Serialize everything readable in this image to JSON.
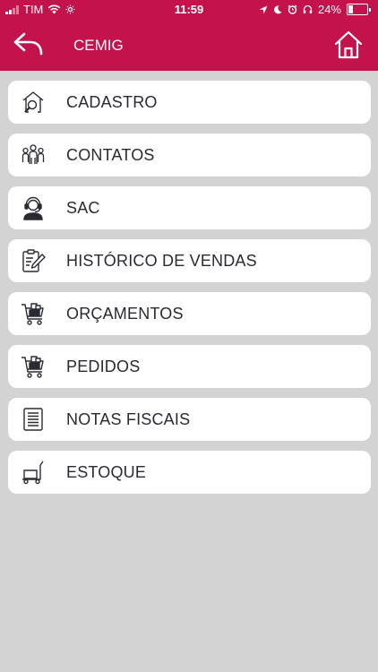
{
  "status_bar": {
    "carrier": "TIM",
    "time": "11:59",
    "battery": "24%",
    "battery_level": 0.24
  },
  "header": {
    "title": "CEMIG",
    "back_icon": "back-arrow-icon",
    "home_icon": "home-icon"
  },
  "menu": {
    "items": [
      {
        "label": "CADASTRO",
        "icon": "house-search-icon"
      },
      {
        "label": "CONTATOS",
        "icon": "people-group-icon"
      },
      {
        "label": "SAC",
        "icon": "headset-agent-icon"
      },
      {
        "label": "HISTÓRICO DE VENDAS",
        "icon": "clipboard-edit-icon"
      },
      {
        "label": "ORÇAMENTOS",
        "icon": "shopping-cart-icon"
      },
      {
        "label": "PEDIDOS",
        "icon": "shopping-cart-icon"
      },
      {
        "label": "NOTAS FISCAIS",
        "icon": "document-lines-icon"
      },
      {
        "label": "ESTOQUE",
        "icon": "hand-truck-icon"
      }
    ]
  },
  "colors": {
    "brand": "#c4124d",
    "background": "#d3d3d3",
    "card": "#ffffff",
    "text": "#2a2a33"
  }
}
